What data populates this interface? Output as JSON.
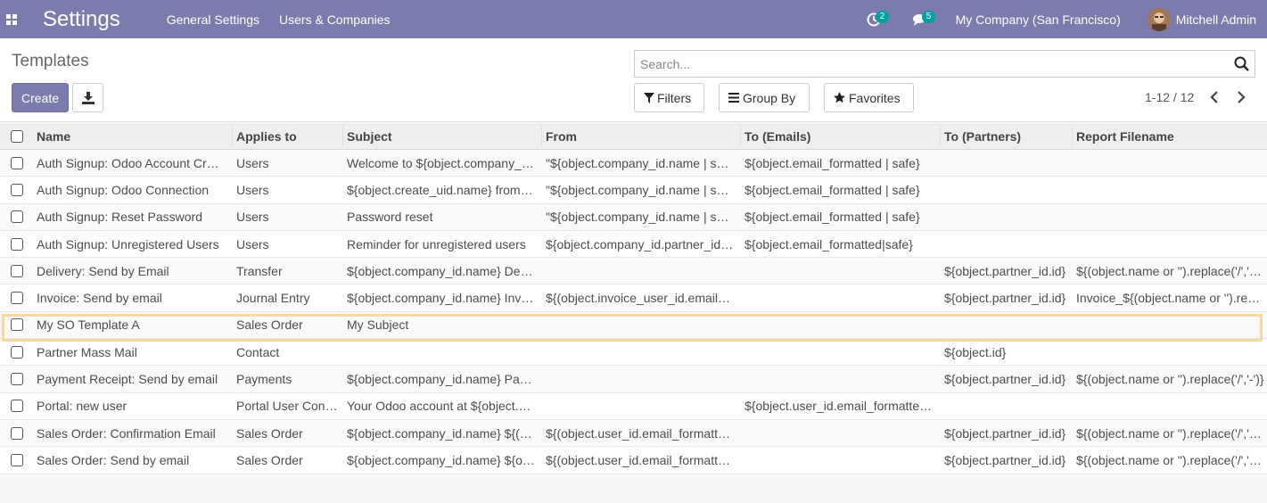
{
  "navbar": {
    "app_title": "Settings",
    "menu": [
      "General Settings",
      "Users & Companies"
    ],
    "activity_count": "2",
    "messages_count": "5",
    "company": "My Company (San Francisco)",
    "user": "Mitchell Admin",
    "color": "#7c7bad"
  },
  "control_panel": {
    "breadcrumb": "Templates",
    "create_label": "Create",
    "search_placeholder": "Search...",
    "filters_label": "Filters",
    "groupby_label": "Group By",
    "favorites_label": "Favorites",
    "pager": "1-12 / 12"
  },
  "table": {
    "headers": [
      "Name",
      "Applies to",
      "Subject",
      "From",
      "To (Emails)",
      "To (Partners)",
      "Report Filename"
    ],
    "rows": [
      [
        "Auth Signup: Odoo Account Cr…",
        "Users",
        "Welcome to ${object.company_…",
        "\"${object.company_id.name | s…",
        "${object.email_formatted | safe}",
        "",
        ""
      ],
      [
        "Auth Signup: Odoo Connection",
        "Users",
        "${object.create_uid.name} from…",
        "\"${object.company_id.name | s…",
        "${object.email_formatted | safe}",
        "",
        ""
      ],
      [
        "Auth Signup: Reset Password",
        "Users",
        "Password reset",
        "\"${object.company_id.name | s…",
        "${object.email_formatted | safe}",
        "",
        ""
      ],
      [
        "Auth Signup: Unregistered Users",
        "Users",
        "Reminder for unregistered users",
        "${object.company_id.partner_id…",
        "${object.email_formatted|safe}",
        "",
        ""
      ],
      [
        "Delivery: Send by Email",
        "Transfer",
        "${object.company_id.name} De…",
        "",
        "",
        "${object.partner_id.id}",
        "${(object.name or '').replace('/','…"
      ],
      [
        "Invoice: Send by email",
        "Journal Entry",
        "${object.company_id.name} Inv…",
        "${(object.invoice_user_id.email…",
        "",
        "${object.partner_id.id}",
        "Invoice_${(object.name or '').re…"
      ],
      [
        "My SO Template A",
        "Sales Order",
        "My Subject",
        "",
        "",
        "",
        ""
      ],
      [
        "Partner Mass Mail",
        "Contact",
        "",
        "",
        "",
        "${object.id}",
        ""
      ],
      [
        "Payment Receipt: Send by email",
        "Payments",
        "${object.company_id.name} Pa…",
        "",
        "",
        "${object.partner_id.id}",
        "${(object.name or '').replace('/','-')}"
      ],
      [
        "Portal: new user",
        "Portal User Con…",
        "Your Odoo account at ${object.…",
        "",
        "${object.user_id.email_formatte…",
        "",
        ""
      ],
      [
        "Sales Order: Confirmation Email",
        "Sales Order",
        "${object.company_id.name} ${(…",
        "${(object.user_id.email_formatt…",
        "",
        "${object.partner_id.id}",
        "${(object.name or '').replace('/','…"
      ],
      [
        "Sales Order: Send by email",
        "Sales Order",
        "${object.company_id.name} ${o…",
        "${(object.user_id.email_formatt…",
        "",
        "${object.partner_id.id}",
        "${(object.name or '').replace('/','…"
      ]
    ]
  }
}
